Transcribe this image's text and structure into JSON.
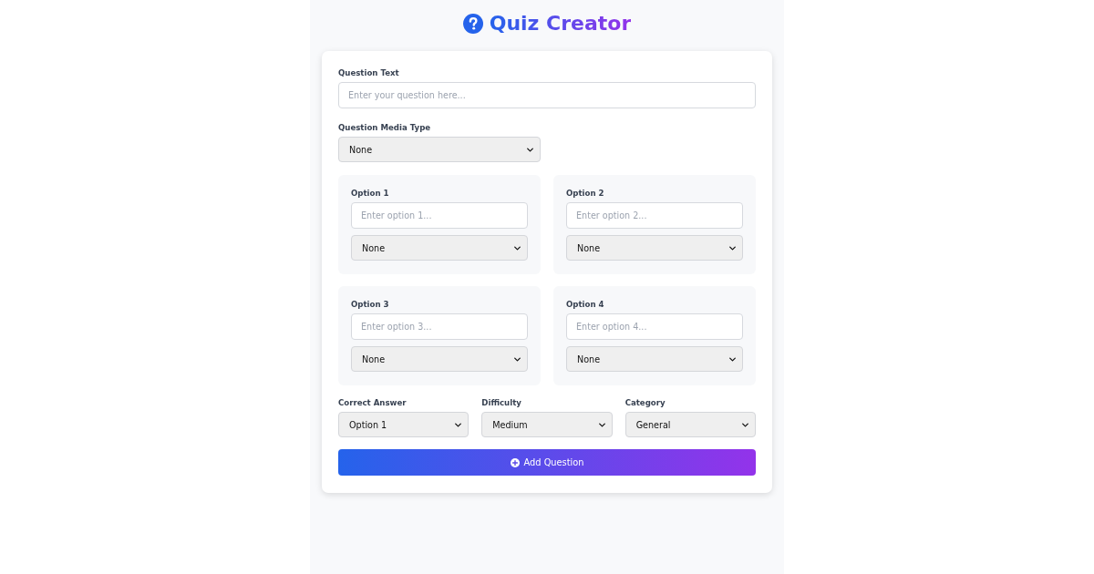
{
  "header": {
    "title": "Quiz Creator"
  },
  "question": {
    "label": "Question Text",
    "placeholder": "Enter your question here..."
  },
  "media_type": {
    "label": "Question Media Type",
    "value": "None"
  },
  "options": [
    {
      "label": "Option 1",
      "placeholder": "Enter option 1...",
      "media_type": "None"
    },
    {
      "label": "Option 2",
      "placeholder": "Enter option 2...",
      "media_type": "None"
    },
    {
      "label": "Option 3",
      "placeholder": "Enter option 3...",
      "media_type": "None"
    },
    {
      "label": "Option 4",
      "placeholder": "Enter option 4...",
      "media_type": "None"
    }
  ],
  "settings": [
    {
      "label": "Correct Answer",
      "value": "Option 1"
    },
    {
      "label": "Difficulty",
      "value": "Medium"
    },
    {
      "label": "Category",
      "value": "General"
    }
  ],
  "submit": {
    "label": "Add Question"
  }
}
